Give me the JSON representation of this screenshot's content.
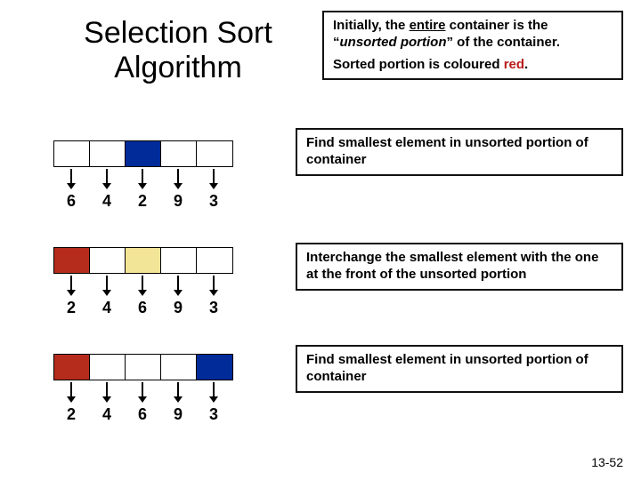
{
  "title_line1": "Selection Sort",
  "title_line2": "Algorithm",
  "notes": {
    "initial_a": "Initially, the ",
    "initial_entire": "entire",
    "initial_b": " container is the “",
    "initial_unsorted": "unsorted portion",
    "initial_c": "” of the container.",
    "sorted_a": "Sorted portion is coloured ",
    "sorted_red": "red",
    "sorted_b": ".",
    "step_find": "Find smallest element in unsorted portion of container",
    "step_swap": "Interchange the smallest element with the one at the front of the unsorted portion"
  },
  "arrays": {
    "a1": {
      "colors": [
        "white",
        "white",
        "blue",
        "white",
        "white"
      ],
      "vals": [
        "6",
        "4",
        "2",
        "9",
        "3"
      ]
    },
    "a2": {
      "colors": [
        "red",
        "white",
        "yellow",
        "white",
        "white"
      ],
      "vals": [
        "2",
        "4",
        "6",
        "9",
        "3"
      ]
    },
    "a3": {
      "colors": [
        "red",
        "white",
        "white",
        "white",
        "blue"
      ],
      "vals": [
        "2",
        "4",
        "6",
        "9",
        "3"
      ]
    }
  },
  "slide_number": "13-52"
}
